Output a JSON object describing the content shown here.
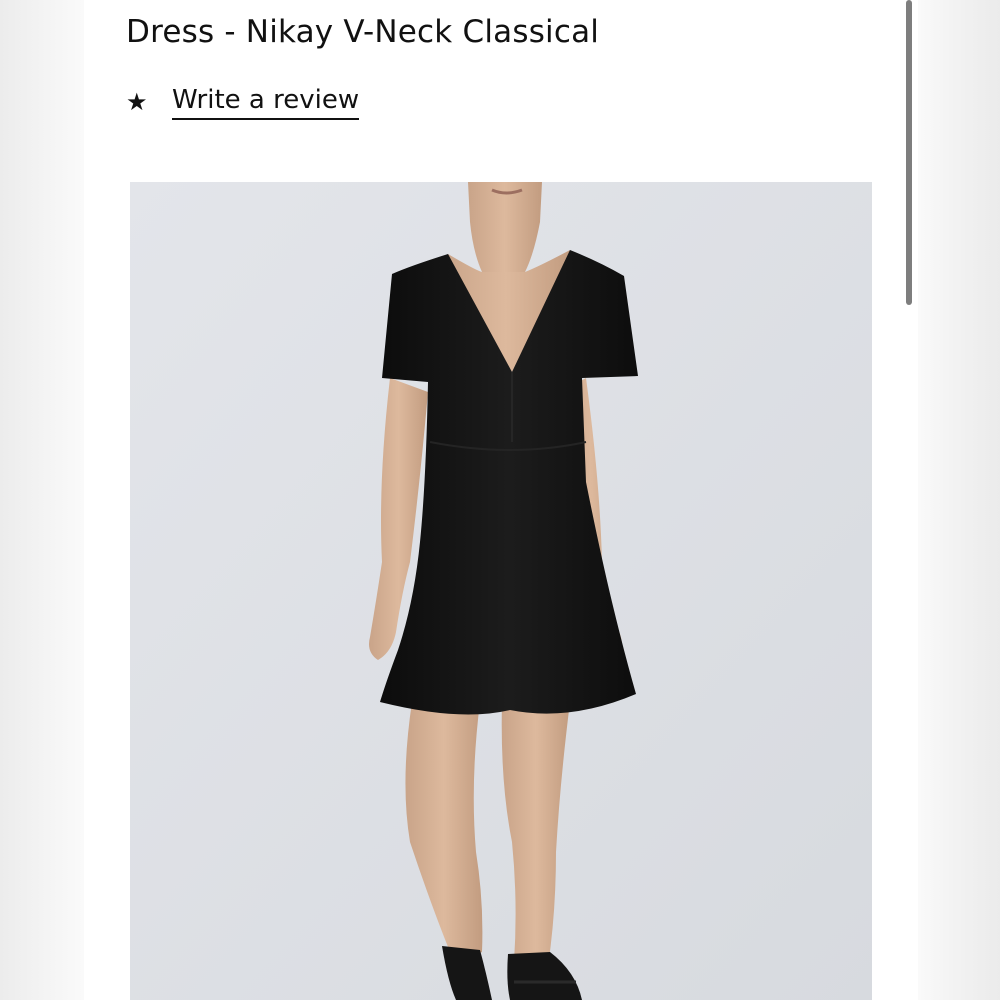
{
  "product": {
    "title": "Dress - Nikay V-Neck Classical",
    "rating_icon": "star-icon",
    "review_link": "Write a review"
  },
  "image": {
    "subject": "product-photo",
    "dress_color": "#141414",
    "background_color": "#dde0e5"
  }
}
